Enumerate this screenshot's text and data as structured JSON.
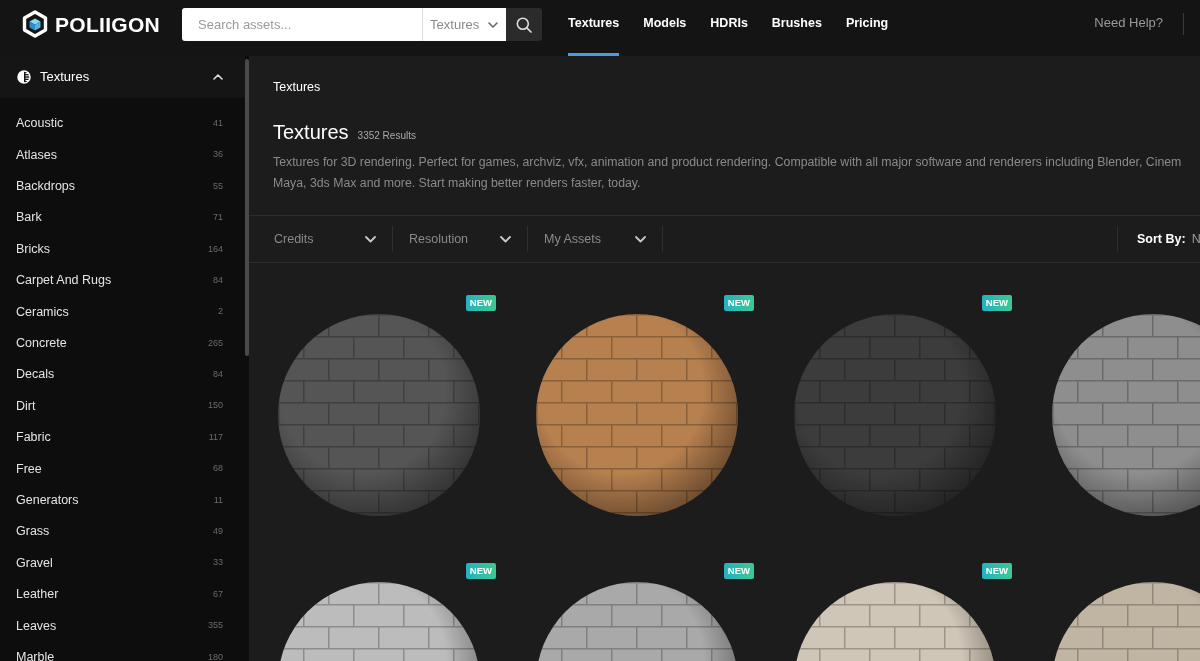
{
  "top_bar": {
    "logo": "POLIIGON",
    "search": {
      "placeholder": "Search assets...",
      "category": "Textures"
    },
    "nav": [
      {
        "label": "Textures",
        "selected": true
      },
      {
        "label": "Models",
        "selected": false
      },
      {
        "label": "HDRIs",
        "selected": false
      },
      {
        "label": "Brushes",
        "selected": false
      },
      {
        "label": "Pricing",
        "selected": false
      }
    ],
    "help_link": "Need Help?"
  },
  "sidebar": {
    "title": "Textures",
    "expanded": true,
    "items": [
      {
        "label": "Acoustic",
        "count": "41"
      },
      {
        "label": "Atlases",
        "count": "36"
      },
      {
        "label": "Backdrops",
        "count": "55"
      },
      {
        "label": "Bark",
        "count": "71"
      },
      {
        "label": "Bricks",
        "count": "164"
      },
      {
        "label": "Carpet And Rugs",
        "count": "84"
      },
      {
        "label": "Ceramics",
        "count": "2"
      },
      {
        "label": "Concrete",
        "count": "265"
      },
      {
        "label": "Decals",
        "count": "84"
      },
      {
        "label": "Dirt",
        "count": "150"
      },
      {
        "label": "Fabric",
        "count": "117"
      },
      {
        "label": "Free",
        "count": "68"
      },
      {
        "label": "Generators",
        "count": "11"
      },
      {
        "label": "Grass",
        "count": "49"
      },
      {
        "label": "Gravel",
        "count": "33"
      },
      {
        "label": "Leather",
        "count": "67"
      },
      {
        "label": "Leaves",
        "count": "355"
      },
      {
        "label": "Marble",
        "count": "180"
      }
    ]
  },
  "header": {
    "breadcrumb": "Textures",
    "title": "Textures",
    "result_count": "3352 Results",
    "description": "Textures for 3D rendering. Perfect for games, archviz, vfx, animation and product rendering. Compatible with all major software and renderers including Blender, Cinem\nMaya, 3ds Max and more. Start making better renders faster, today."
  },
  "filters": [
    {
      "label": "Credits"
    },
    {
      "label": "Resolution"
    },
    {
      "label": "My Assets"
    }
  ],
  "sort": {
    "label": "Sort By:",
    "value": "N"
  },
  "cards": [
    {
      "badge": "NEW",
      "color": "#555555"
    },
    {
      "badge": "NEW",
      "color": "#b7804f"
    },
    {
      "badge": "NEW",
      "color": "#3c3c3c"
    },
    {
      "color": "#8e8e8e"
    },
    {
      "badge": "NEW",
      "color": "#bcbcbc"
    },
    {
      "badge": "NEW",
      "color": "#a9a9a9"
    },
    {
      "badge": "NEW",
      "color": "#d0c6b7"
    },
    {
      "color": "#c0b5a2"
    }
  ]
}
